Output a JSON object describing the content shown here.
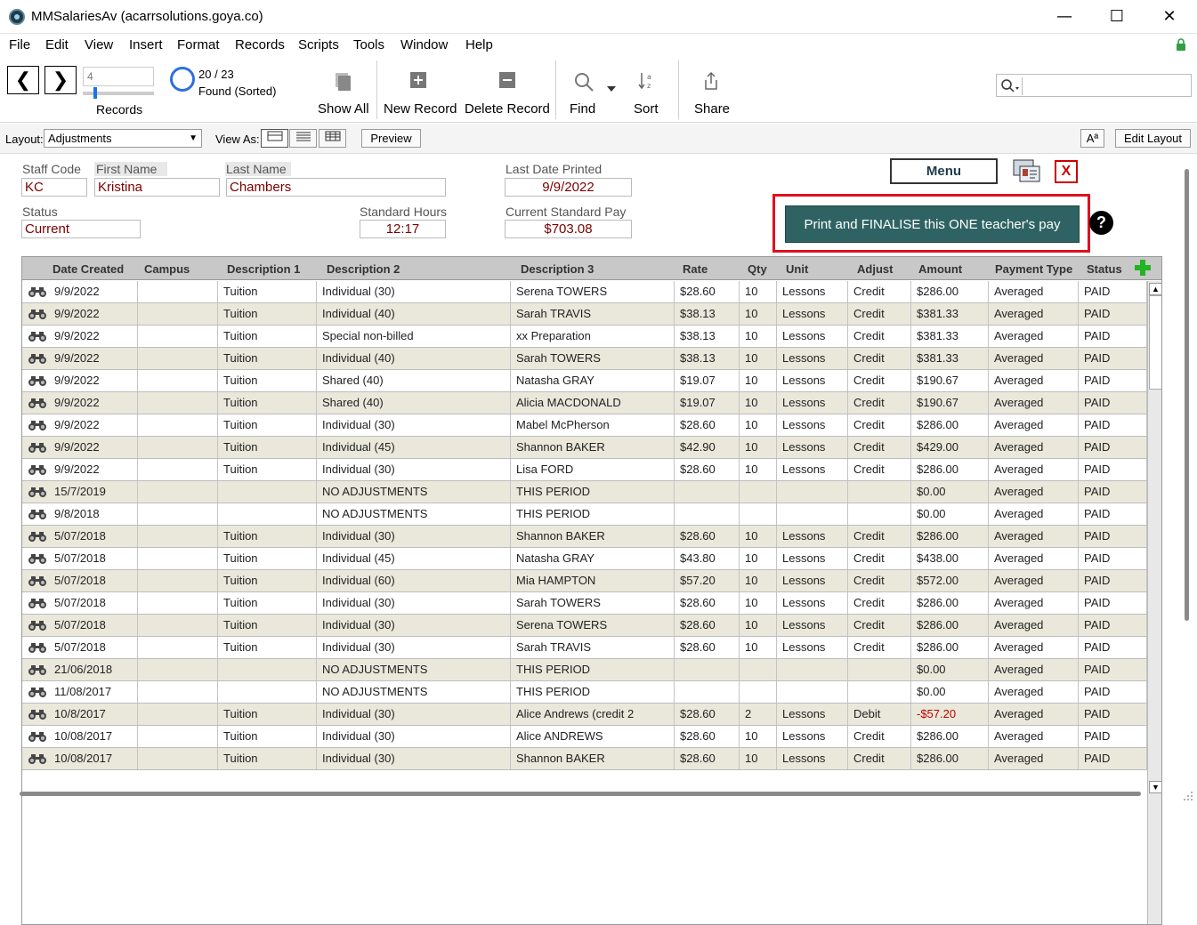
{
  "window": {
    "title": "MMSalariesAv (acarrsolutions.goya.co)",
    "controls": {
      "minimize": "—",
      "maximize": "☐",
      "close": "✕"
    }
  },
  "menu": [
    "File",
    "Edit",
    "View",
    "Insert",
    "Format",
    "Records",
    "Scripts",
    "Tools",
    "Window",
    "Help"
  ],
  "toolbar": {
    "prev": "❮",
    "next": "❯",
    "record_number": "4",
    "records_label": "Records",
    "found_count": "20 / 23",
    "found_label": "Found (Sorted)",
    "show_all": "Show All",
    "new_record": "New Record",
    "delete_record": "Delete Record",
    "find": "Find",
    "sort": "Sort",
    "share": "Share",
    "search_placeholder": ""
  },
  "layoutbar": {
    "layout_label": "Layout:",
    "layout_value": "Adjustments",
    "view_as_label": "View As:",
    "preview": "Preview",
    "font_size": "Aª",
    "edit_layout": "Edit Layout"
  },
  "record": {
    "staff_code_label": "Staff Code",
    "staff_code": "KC",
    "first_name_label": "First Name",
    "first_name": "Kristina",
    "last_name_label": "Last Name",
    "last_name": "Chambers",
    "last_date_printed_label": "Last Date Printed",
    "last_date_printed": "9/9/2022",
    "status_label": "Status",
    "status": "Current",
    "standard_hours_label": "Standard Hours",
    "standard_hours": "12:17",
    "current_standard_pay_label": "Current Standard Pay",
    "current_standard_pay": "$703.08"
  },
  "buttons": {
    "menu": "Menu",
    "close_x": "X",
    "finalise": "Print and FINALISE this ONE teacher's pay",
    "help": "?"
  },
  "table": {
    "headers": [
      "Date Created",
      "Campus",
      "Description 1",
      "Description 2",
      "Description 3",
      "Rate",
      "Qty",
      "Unit",
      "Adjust",
      "Amount",
      "Payment Type",
      "Status"
    ],
    "rows": [
      [
        "9/9/2022",
        "",
        "Tuition",
        "Individual (30)",
        "Serena TOWERS",
        "$28.60",
        "10",
        "Lessons",
        "Credit",
        "$286.00",
        "Averaged",
        "PAID"
      ],
      [
        "9/9/2022",
        "",
        "Tuition",
        "Individual (40)",
        "Sarah TRAVIS",
        "$38.13",
        "10",
        "Lessons",
        "Credit",
        "$381.33",
        "Averaged",
        "PAID"
      ],
      [
        "9/9/2022",
        "",
        "Tuition",
        "Special non-billed",
        "xx Preparation",
        "$38.13",
        "10",
        "Lessons",
        "Credit",
        "$381.33",
        "Averaged",
        "PAID"
      ],
      [
        "9/9/2022",
        "",
        "Tuition",
        "Individual (40)",
        "Sarah TOWERS",
        "$38.13",
        "10",
        "Lessons",
        "Credit",
        "$381.33",
        "Averaged",
        "PAID"
      ],
      [
        "9/9/2022",
        "",
        "Tuition",
        "Shared (40)",
        "Natasha GRAY",
        "$19.07",
        "10",
        "Lessons",
        "Credit",
        "$190.67",
        "Averaged",
        "PAID"
      ],
      [
        "9/9/2022",
        "",
        "Tuition",
        "Shared (40)",
        "Alicia MACDONALD",
        "$19.07",
        "10",
        "Lessons",
        "Credit",
        "$190.67",
        "Averaged",
        "PAID"
      ],
      [
        "9/9/2022",
        "",
        "Tuition",
        "Individual (30)",
        "Mabel McPherson",
        "$28.60",
        "10",
        "Lessons",
        "Credit",
        "$286.00",
        "Averaged",
        "PAID"
      ],
      [
        "9/9/2022",
        "",
        "Tuition",
        "Individual (45)",
        "Shannon BAKER",
        "$42.90",
        "10",
        "Lessons",
        "Credit",
        "$429.00",
        "Averaged",
        "PAID"
      ],
      [
        "9/9/2022",
        "",
        "Tuition",
        "Individual (30)",
        "Lisa FORD",
        "$28.60",
        "10",
        "Lessons",
        "Credit",
        "$286.00",
        "Averaged",
        "PAID"
      ],
      [
        "15/7/2019",
        "",
        "",
        "NO ADJUSTMENTS",
        "THIS PERIOD",
        "",
        "",
        "",
        "",
        "$0.00",
        "Averaged",
        "PAID"
      ],
      [
        "9/8/2018",
        "",
        "",
        "NO ADJUSTMENTS",
        "THIS PERIOD",
        "",
        "",
        "",
        "",
        "$0.00",
        "Averaged",
        "PAID"
      ],
      [
        "5/07/2018",
        "",
        "Tuition",
        "Individual (30)",
        "Shannon BAKER",
        "$28.60",
        "10",
        "Lessons",
        "Credit",
        "$286.00",
        "Averaged",
        "PAID"
      ],
      [
        "5/07/2018",
        "",
        "Tuition",
        "Individual (45)",
        "Natasha GRAY",
        "$43.80",
        "10",
        "Lessons",
        "Credit",
        "$438.00",
        "Averaged",
        "PAID"
      ],
      [
        "5/07/2018",
        "",
        "Tuition",
        "Individual (60)",
        "Mia HAMPTON",
        "$57.20",
        "10",
        "Lessons",
        "Credit",
        "$572.00",
        "Averaged",
        "PAID"
      ],
      [
        "5/07/2018",
        "",
        "Tuition",
        "Individual (30)",
        "Sarah TOWERS",
        "$28.60",
        "10",
        "Lessons",
        "Credit",
        "$286.00",
        "Averaged",
        "PAID"
      ],
      [
        "5/07/2018",
        "",
        "Tuition",
        "Individual (30)",
        "Serena TOWERS",
        "$28.60",
        "10",
        "Lessons",
        "Credit",
        "$286.00",
        "Averaged",
        "PAID"
      ],
      [
        "5/07/2018",
        "",
        "Tuition",
        "Individual (30)",
        "Sarah TRAVIS",
        "$28.60",
        "10",
        "Lessons",
        "Credit",
        "$286.00",
        "Averaged",
        "PAID"
      ],
      [
        "21/06/2018",
        "",
        "",
        "NO ADJUSTMENTS",
        "THIS PERIOD",
        "",
        "",
        "",
        "",
        "$0.00",
        "Averaged",
        "PAID"
      ],
      [
        "11/08/2017",
        "",
        "",
        "NO ADJUSTMENTS",
        "THIS PERIOD",
        "",
        "",
        "",
        "",
        "$0.00",
        "Averaged",
        "PAID"
      ],
      [
        "10/8/2017",
        "",
        "Tuition",
        "Individual (30)",
        "Alice Andrews (credit 2",
        "$28.60",
        "2",
        "Lessons",
        "Debit",
        "-$57.20",
        "Averaged",
        "PAID"
      ],
      [
        "10/08/2017",
        "",
        "Tuition",
        "Individual (30)",
        "Alice ANDREWS",
        "$28.60",
        "10",
        "Lessons",
        "Credit",
        "$286.00",
        "Averaged",
        "PAID"
      ],
      [
        "10/08/2017",
        "",
        "Tuition",
        "Individual (30)",
        "Shannon BAKER",
        "$28.60",
        "10",
        "Lessons",
        "Credit",
        "$286.00",
        "Averaged",
        "PAID"
      ]
    ]
  },
  "colors": {
    "accent": "#2f6363",
    "highlight_frame": "#e01020",
    "alt_row": "#e9e8db",
    "field_text": "#7a0000",
    "negative": "#c00000"
  },
  "icons": {
    "app": "app-logo-icon",
    "lock": "lock-icon",
    "show_all": "show-all-icon",
    "new_record": "plus-square-icon",
    "delete_record": "minus-square-icon",
    "find": "magnifier-icon",
    "sort": "sort-az-icon",
    "share": "share-icon",
    "row": "binoculars-icon",
    "add_row": "green-plus-icon",
    "help": "question-icon"
  }
}
